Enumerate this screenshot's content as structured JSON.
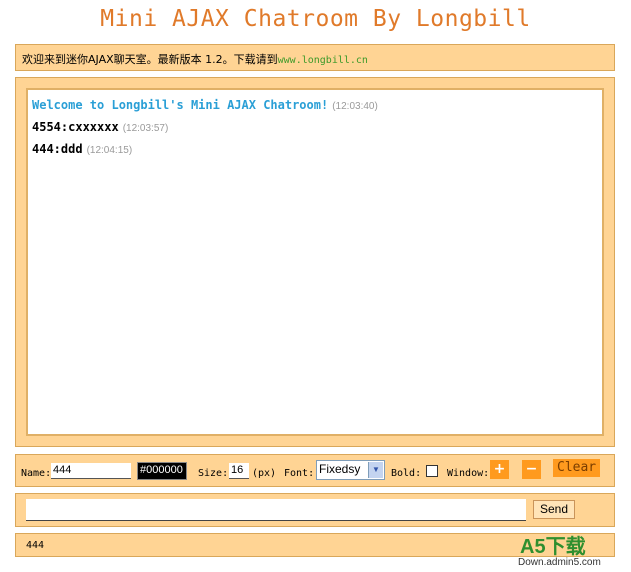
{
  "title": "Mini AJAX Chatroom By Longbill",
  "notice": {
    "text": "欢迎来到迷你AJAX聊天室。最新版本 1.2。下载请到",
    "link": "www.longbill.cn"
  },
  "messages": [
    {
      "who": "Welcome to Longbill's Mini AJAX Chatroom!",
      "time": "(12:03:40)",
      "system": true
    },
    {
      "who": "4554:cxxxxxx",
      "time": "(12:03:57)",
      "system": false
    },
    {
      "who": "444:ddd",
      "time": "(12:04:15)",
      "system": false
    }
  ],
  "controls": {
    "name_label": "Name:",
    "name_value": "444",
    "color_value": "#000000",
    "size_label": "Size:",
    "size_value": "16",
    "size_unit": "(px)",
    "font_label": "Font:",
    "font_value": "Fixedsy",
    "bold_label": "Bold:",
    "window_label": "Window:",
    "plus": "+",
    "minus": "−",
    "clear_label": "Clear"
  },
  "send": {
    "input_value": "",
    "button_label": "Send"
  },
  "status": {
    "text": "444"
  },
  "watermark": {
    "brand": "A5下载",
    "site": "Down.admin5.com"
  },
  "colors": {
    "title": "#e07a2a",
    "panel": "#ffd494",
    "system_message": "#2a9fd6",
    "button": "#ff9a1e"
  }
}
